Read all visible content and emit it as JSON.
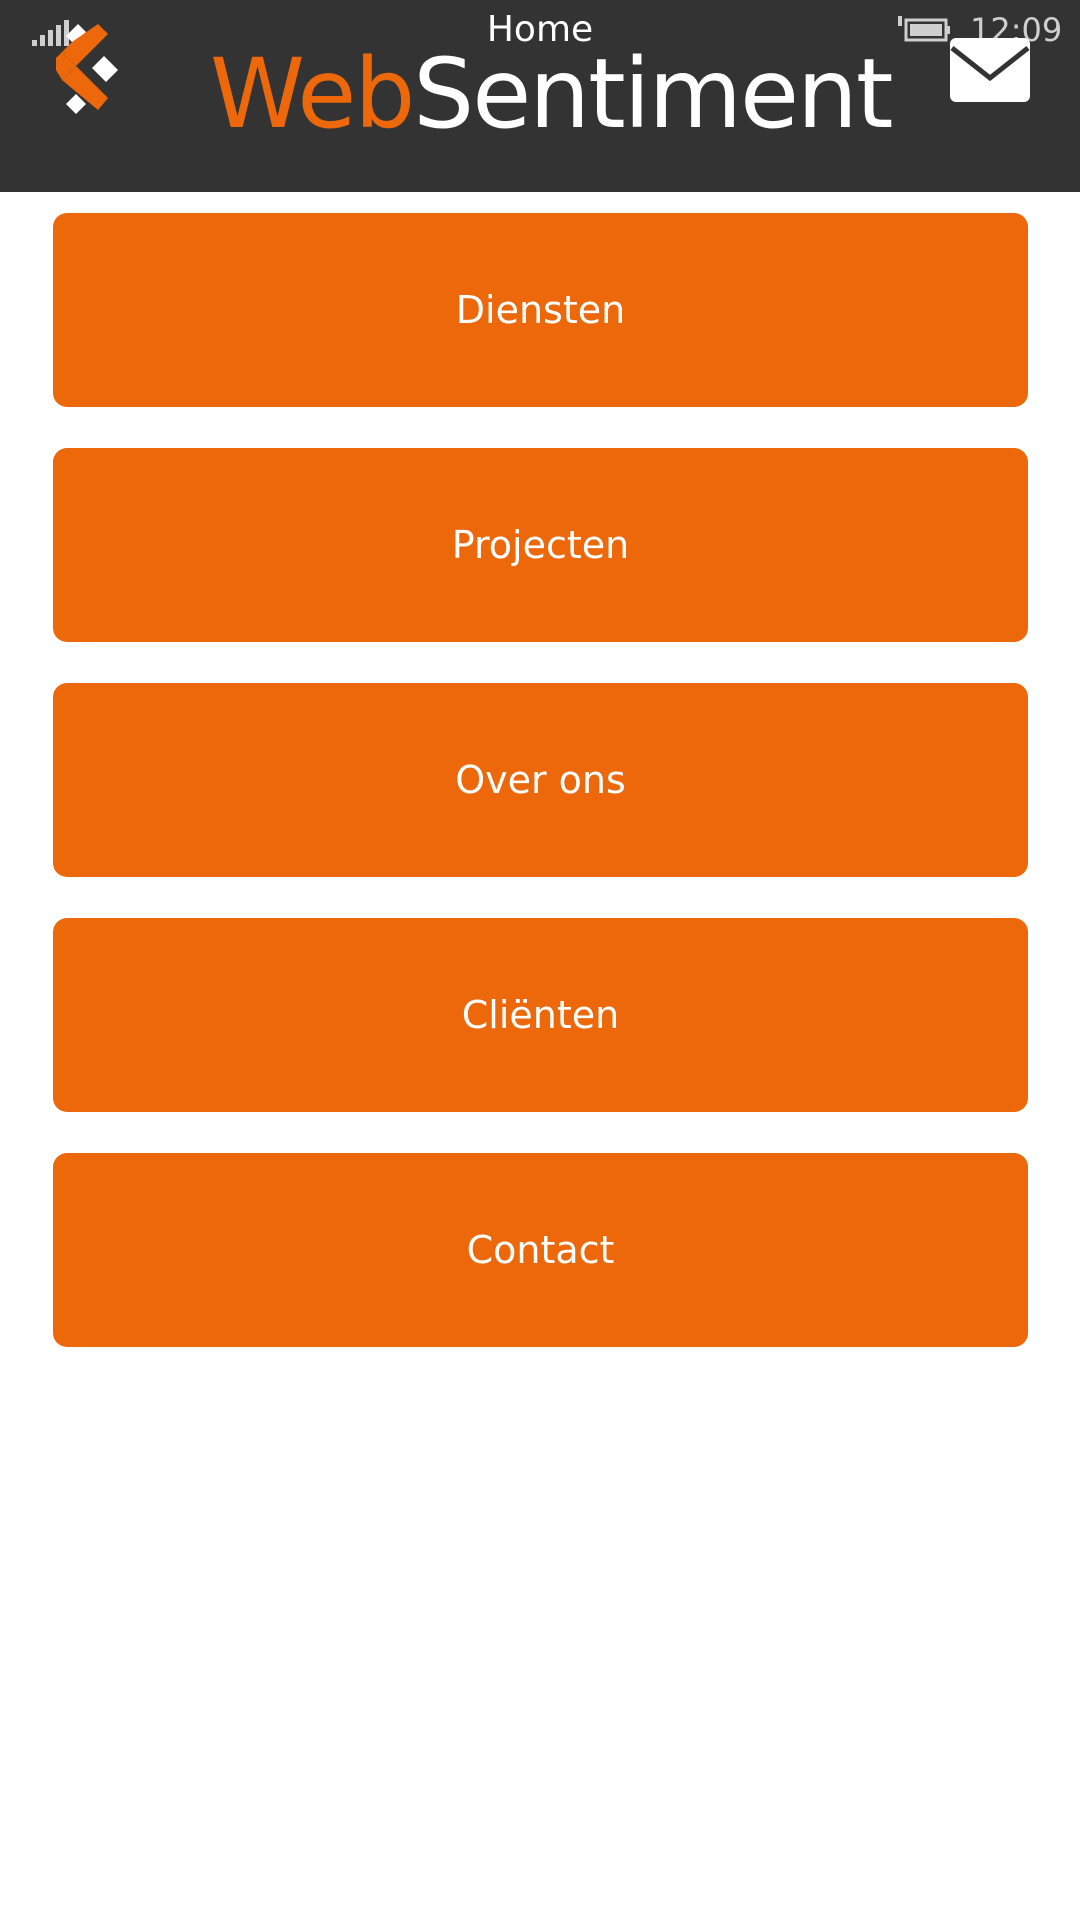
{
  "status_bar": {
    "time": "12:09",
    "icons": [
      "signal-strength-icon",
      "battery-charging-icon"
    ]
  },
  "header": {
    "title": "Home",
    "brand_part1": "Web",
    "brand_part2": "Sentiment",
    "logo_icon": "websentiment-logo-icon",
    "mail_icon": "mail-icon"
  },
  "colors": {
    "accent": "#ec680b",
    "header_bg": "#333333",
    "background": "#ffffff"
  },
  "menu": {
    "items": [
      {
        "label": "Diensten"
      },
      {
        "label": "Projecten"
      },
      {
        "label": "Over ons"
      },
      {
        "label": "Cliënten"
      },
      {
        "label": "Contact"
      }
    ]
  }
}
